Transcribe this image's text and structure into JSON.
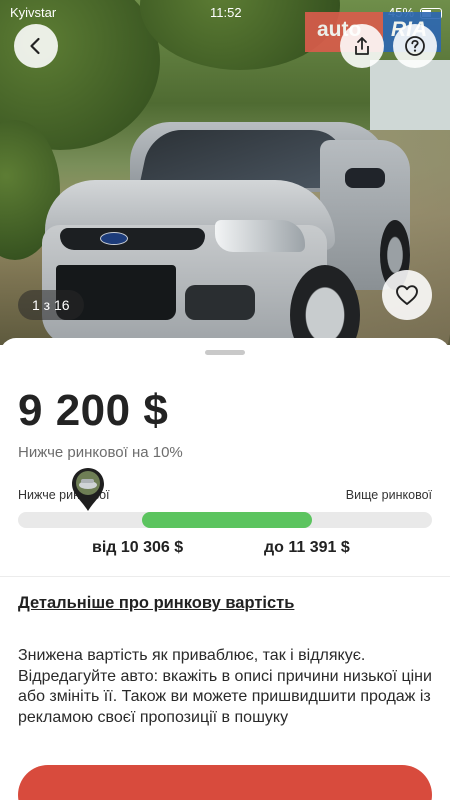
{
  "status_bar": {
    "carrier": "Kyivstar",
    "time": "11:52",
    "battery": "45%"
  },
  "header": {
    "logo_left": "auto",
    "logo_right": "RIA",
    "photo_counter": "1 з 16"
  },
  "price": {
    "value": "9 200 $",
    "comparison": "Нижче ринкової на 10%"
  },
  "market_scale": {
    "label_below": "Нижче ринкової",
    "label_above": "Вище ринкової",
    "range_start_fraction": 0.3,
    "range_end_fraction": 0.71,
    "from_label": "від 10 306 $",
    "to_label": "до 11 391 $"
  },
  "details_link": "Детальніше про ринкову вартість",
  "advice_text": "Знижена вартість як приваблює, так і відлякує. Відредагуйте авто: вкажіть в описі причини низької ціни або змініть її. Також ви можете пришвидшити продаж із рекламою своєї пропозиції в пошуку",
  "colors": {
    "range_fill": "#5cc45f",
    "cta": "#d84b3d",
    "logo_auto": "#db5c4c",
    "logo_ria": "#2d67b3"
  }
}
